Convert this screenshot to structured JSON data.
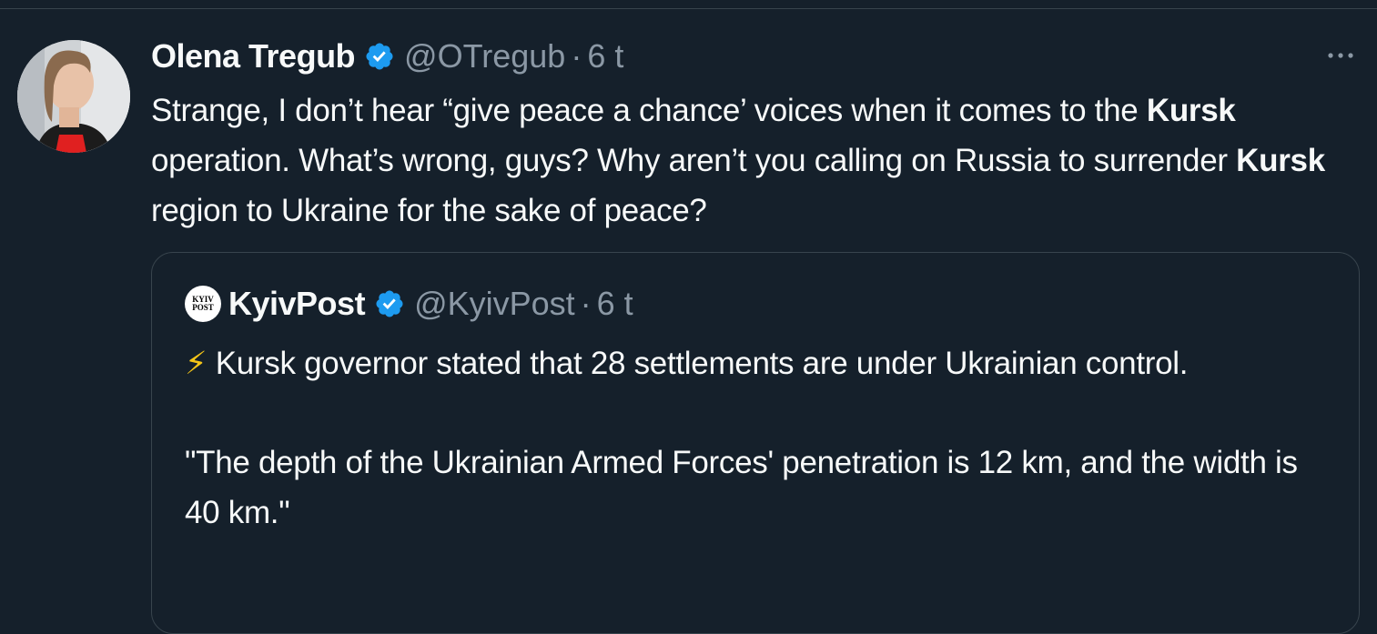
{
  "tweet": {
    "author": {
      "name": "Olena Tregub",
      "handle": "@OTregub",
      "time": "6 t",
      "verified": true
    },
    "more_icon": "more-horizontal-icon",
    "text": {
      "part1": "Strange, I don’t hear “give peace a chance’ voices when it comes to the ",
      "kw1": "Kursk",
      "part2": " operation. What’s wrong, guys? Why aren’t you calling on Russia to surrender ",
      "kw2": "Kursk",
      "part3": " region to Ukraine for the sake of peace?"
    }
  },
  "quote": {
    "author": {
      "name": "KyivPost",
      "handle": "@KyivPost",
      "time": "6 t",
      "verified": true,
      "logo_line1": "KYIV",
      "logo_line2": "POST"
    },
    "bolt_icon": "⚡",
    "paragraph1": "Kursk governor stated that 28 settlements are under Ukrainian control.",
    "paragraph2": "\"The depth of the Ukrainian Armed Forces' penetration is 12 km, and the width is 40 km.\""
  },
  "colors": {
    "background": "#15202b",
    "text": "#f7f9f9",
    "secondary": "#8b98a5",
    "verified": "#1d9bf0",
    "border": "#38444d"
  }
}
